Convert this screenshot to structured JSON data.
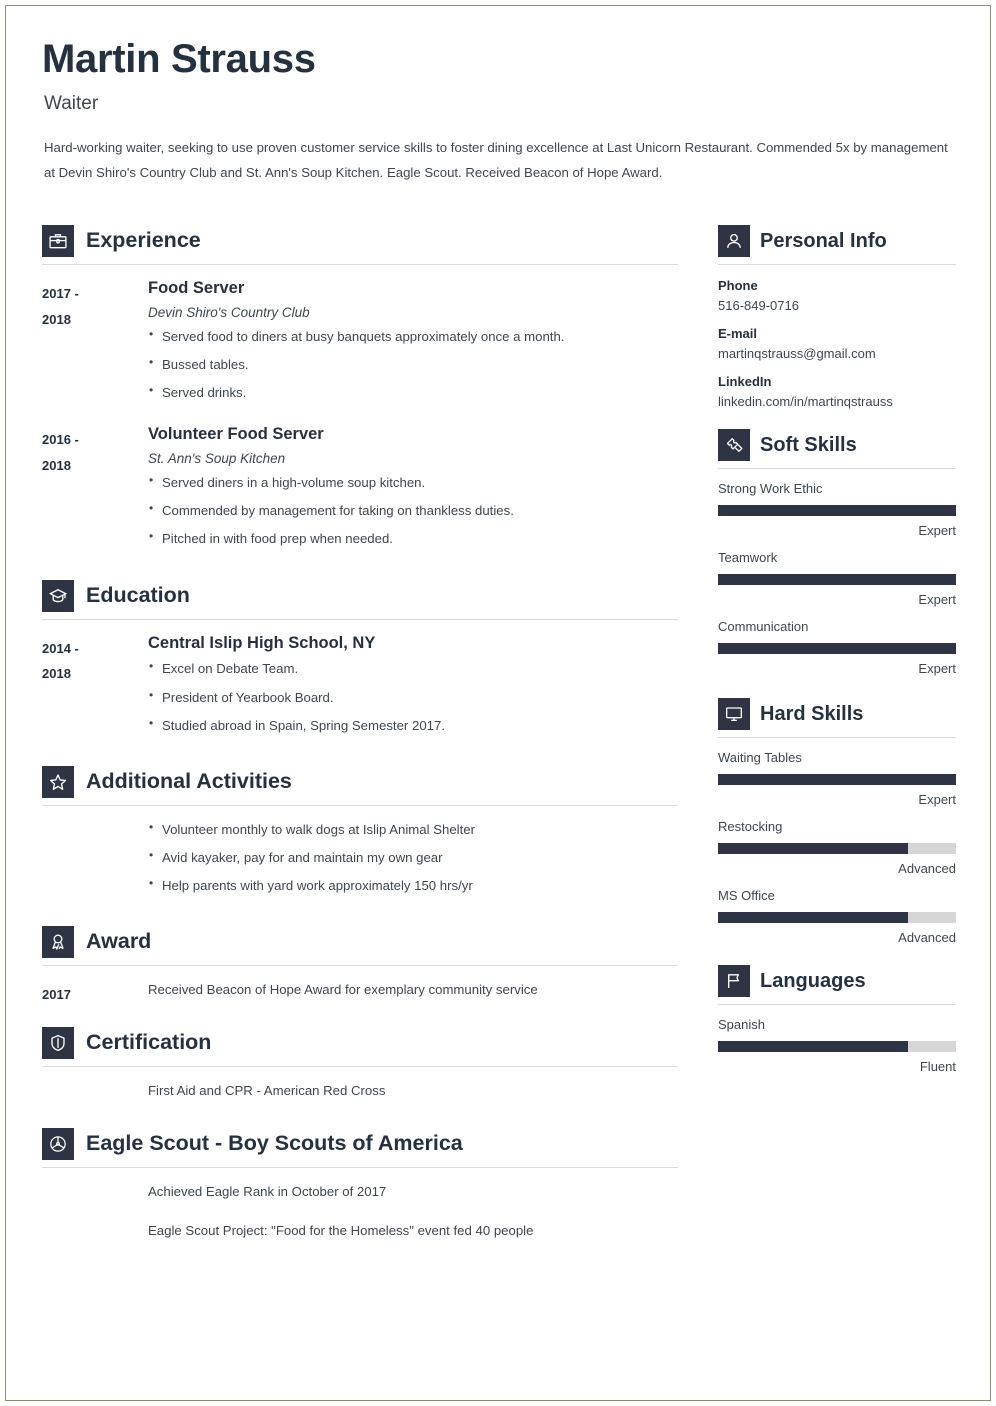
{
  "header": {
    "name": "Martin Strauss",
    "job_title": "Waiter",
    "summary": "Hard-working waiter, seeking to use proven customer service skills to foster dining excellence at Last Unicorn Restaurant. Commended 5x by management at Devin Shiro's Country Club and St. Ann's Soup Kitchen. Eagle Scout. Received Beacon of Hope Award."
  },
  "left": {
    "experience": {
      "icon": "briefcase-icon",
      "title": "Experience",
      "entries": [
        {
          "date_start": "2017 -",
          "date_end": "2018",
          "title": "Food Server",
          "subtitle": "Devin Shiro's Country Club",
          "bullets": [
            "Served food to diners at busy banquets approximately once a month.",
            "Bussed tables.",
            "Served drinks."
          ]
        },
        {
          "date_start": "2016 -",
          "date_end": "2018",
          "title": "Volunteer Food Server",
          "subtitle": "St. Ann's Soup Kitchen",
          "bullets": [
            "Served diners in a high-volume soup kitchen.",
            "Commended by management for taking on thankless duties.",
            "Pitched in with food prep when needed."
          ]
        }
      ]
    },
    "education": {
      "icon": "graduation-cap-icon",
      "title": "Education",
      "entries": [
        {
          "date_start": "2014 -",
          "date_end": "2018",
          "title": "Central Islip High School, NY",
          "bullets": [
            "Excel on Debate Team.",
            "President of Yearbook Board.",
            "Studied abroad in Spain, Spring Semester 2017."
          ]
        }
      ]
    },
    "activities": {
      "icon": "star-icon",
      "title": "Additional Activities",
      "bullets": [
        "Volunteer monthly to walk dogs at Islip Animal Shelter",
        "Avid kayaker, pay for and maintain my own gear",
        "Help parents with yard work approximately 150 hrs/yr"
      ]
    },
    "award": {
      "icon": "medal-icon",
      "title": "Award",
      "date": "2017",
      "text": "Received Beacon of Hope Award for exemplary community service"
    },
    "certification": {
      "icon": "shield-icon",
      "title": "Certification",
      "text": "First Aid and CPR - American Red Cross"
    },
    "eagle_scout": {
      "icon": "scout-emblem-icon",
      "title": "Eagle Scout - Boy Scouts of America",
      "lines": [
        "Achieved Eagle Rank in October of 2017",
        "Eagle Scout Project: \"Food for the Homeless\" event fed 40 people"
      ]
    }
  },
  "right": {
    "personal_info": {
      "icon": "person-icon",
      "title": "Personal Info",
      "fields": [
        {
          "label": "Phone",
          "value": "516-849-0716"
        },
        {
          "label": "E-mail",
          "value": "martinqstrauss@gmail.com"
        },
        {
          "label": "LinkedIn",
          "value": "linkedin.com/in/martinqstrauss"
        }
      ]
    },
    "soft_skills": {
      "icon": "puzzle-icon",
      "title": "Soft Skills",
      "items": [
        {
          "name": "Strong Work Ethic",
          "level": "Expert",
          "percent": 100
        },
        {
          "name": "Teamwork",
          "level": "Expert",
          "percent": 100
        },
        {
          "name": "Communication",
          "level": "Expert",
          "percent": 100
        }
      ]
    },
    "hard_skills": {
      "icon": "monitor-icon",
      "title": "Hard Skills",
      "items": [
        {
          "name": "Waiting Tables",
          "level": "Expert",
          "percent": 100
        },
        {
          "name": "Restocking",
          "level": "Advanced",
          "percent": 80
        },
        {
          "name": "MS Office",
          "level": "Advanced",
          "percent": 80
        }
      ]
    },
    "languages": {
      "icon": "flag-icon",
      "title": "Languages",
      "items": [
        {
          "name": "Spanish",
          "level": "Fluent",
          "percent": 80
        }
      ]
    }
  },
  "colors": {
    "accent_dark": "#2e3443",
    "heading": "#26313f",
    "body_text": "#3f4650",
    "rule": "#d8dade",
    "bar_track": "#d6d6d6",
    "page_border": "#8b8d78"
  }
}
